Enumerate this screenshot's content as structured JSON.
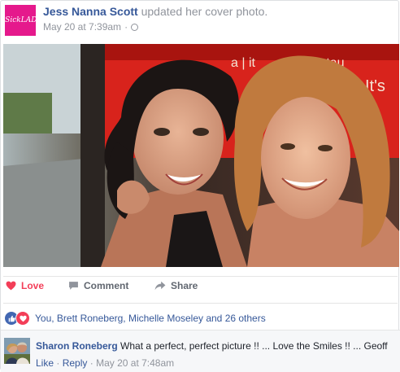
{
  "post": {
    "author": "Jess Nanna Scott",
    "action": "updated her cover photo.",
    "timestamp": "May 20 at 7:39am",
    "separator": "·",
    "avatar_text": "#SickLADY"
  },
  "photo": {
    "sign_text_1": "a | it",
    "sign_text_2": "restau",
    "sign_text_3": "It's"
  },
  "actions": {
    "love_label": "Love",
    "comment_label": "Comment",
    "share_label": "Share"
  },
  "reactions": {
    "text": "You, Brett Roneberg, Michelle Moseley and 26 others"
  },
  "comment": {
    "author": "Sharon Roneberg",
    "text": "What a perfect, perfect picture !! ... Love the Smiles !! ... Geoff",
    "like_label": "Like",
    "reply_label": "Reply",
    "separator": "·",
    "timestamp": "May 20 at 7:48am"
  },
  "colors": {
    "link_blue": "#365899",
    "love_red": "#f33e58",
    "like_blue": "#4267b2",
    "avatar_pink": "#e5198c"
  }
}
